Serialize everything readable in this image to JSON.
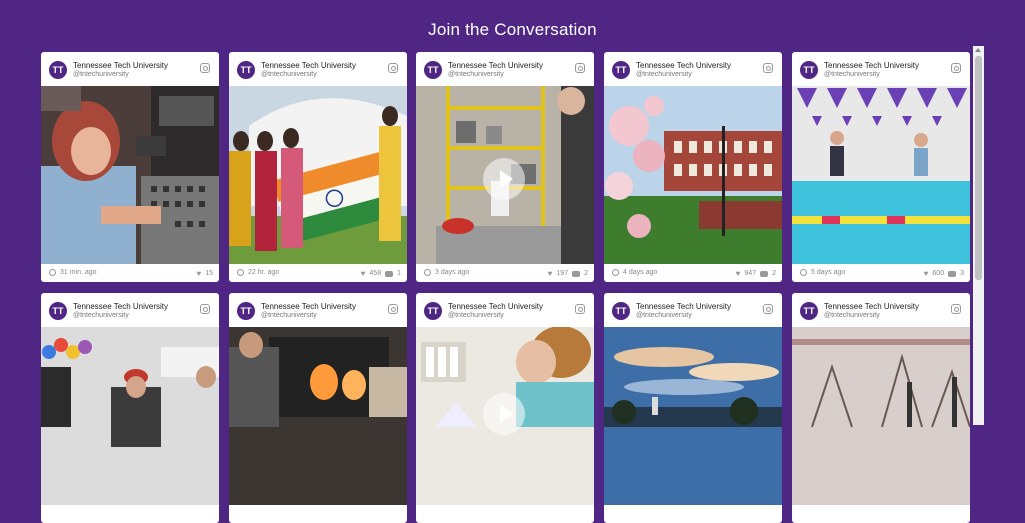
{
  "page": {
    "title": "Join the Conversation"
  },
  "account": {
    "name": "Tennessee Tech University",
    "handle": "@tntechuniversity"
  },
  "posts": [
    {
      "time": "31 min. ago",
      "likes": "15",
      "comments": ""
    },
    {
      "time": "22 hr. ago",
      "likes": "458",
      "comments": "1"
    },
    {
      "time": "3 days ago",
      "likes": "197",
      "comments": "2"
    },
    {
      "time": "4 days ago",
      "likes": "947",
      "comments": "2"
    },
    {
      "time": "5 days ago",
      "likes": "600",
      "comments": "3"
    }
  ],
  "colors": {
    "background": "#4f2683",
    "card": "#ffffff"
  },
  "icons": [
    "instagram-icon",
    "clock-icon",
    "heart-icon",
    "comment-icon",
    "play-icon"
  ]
}
